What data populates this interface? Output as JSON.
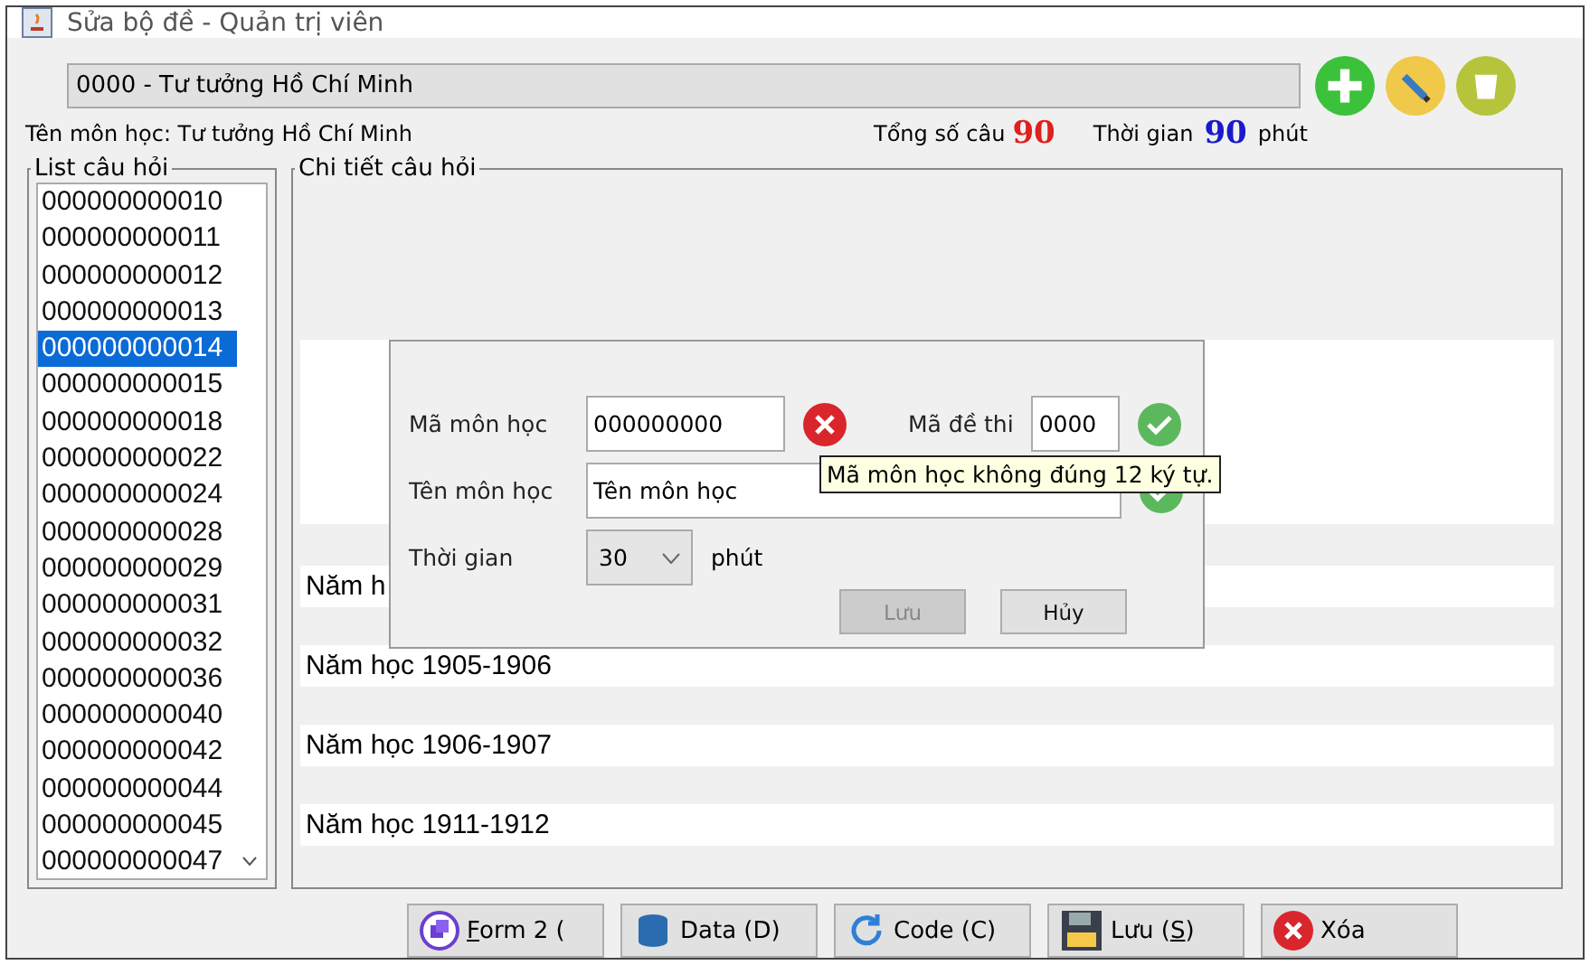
{
  "window": {
    "title": "Sửa bộ đề - Quản trị viên"
  },
  "subject_combo": {
    "value": "0000 - Tư tưởng Hồ Chí Minh"
  },
  "toolbar": [
    {
      "kind": "add"
    },
    {
      "kind": "edit"
    },
    {
      "kind": "delete"
    }
  ],
  "subject_name": "Tên môn học: Tư tưởng Hồ Chí Minh",
  "stats": {
    "total_label": "Tổng số câu",
    "total": "90",
    "time_label": "Thời gian",
    "time": "90",
    "time_unit": "phút"
  },
  "question_list": {
    "title": "List câu hỏi",
    "items": [
      {
        "label": "000000000010",
        "selected": false
      },
      {
        "label": "000000000011",
        "selected": false
      },
      {
        "label": "000000000012",
        "selected": false
      },
      {
        "label": "000000000013",
        "selected": false
      },
      {
        "label": "000000000014",
        "selected": true
      },
      {
        "label": "000000000015",
        "selected": false
      },
      {
        "label": "000000000018",
        "selected": false
      },
      {
        "label": "000000000022",
        "selected": false
      },
      {
        "label": "000000000024",
        "selected": false
      },
      {
        "label": "000000000028",
        "selected": false
      },
      {
        "label": "000000000029",
        "selected": false
      },
      {
        "label": "000000000031",
        "selected": false
      },
      {
        "label": "000000000032",
        "selected": false
      },
      {
        "label": "000000000036",
        "selected": false
      },
      {
        "label": "000000000040",
        "selected": false
      },
      {
        "label": "000000000042",
        "selected": false
      },
      {
        "label": "000000000044",
        "selected": false
      },
      {
        "label": "000000000045",
        "selected": false
      },
      {
        "label": "000000000047",
        "selected": false
      }
    ]
  },
  "detail": {
    "title": "Chi tiết câu hỏi",
    "rows": [
      "Năm h",
      "Năm học 1905-1906",
      "Năm học 1906-1907",
      "Năm học 1911-1912"
    ]
  },
  "dialog": {
    "subject_code": {
      "label": "Mã môn học",
      "value": "000000000",
      "valid": false
    },
    "exam_code": {
      "label": "Mã đề thi",
      "value": "0000",
      "valid": true
    },
    "subject_name": {
      "label": "Tên môn học",
      "value": "Tên môn học",
      "valid": true
    },
    "duration": {
      "label": "Thời gian",
      "value": "30",
      "unit": "phút"
    },
    "buttons": [
      {
        "label": "Lưu",
        "disabled": true
      },
      {
        "label": "Hủy",
        "disabled": false
      }
    ],
    "tooltip": "Mã môn học không đúng 12 ký tự."
  },
  "buttons": [
    {
      "kind": "layers",
      "key": "F",
      "after": "orm 2 ("
    },
    {
      "kind": "data",
      "before": "Data (D)"
    },
    {
      "kind": "refresh",
      "before": "Code (C)"
    },
    {
      "kind": "save",
      "before": "Lưu (",
      "key": "S",
      "after": ")"
    },
    {
      "kind": "delete",
      "before": "Xóa"
    }
  ]
}
